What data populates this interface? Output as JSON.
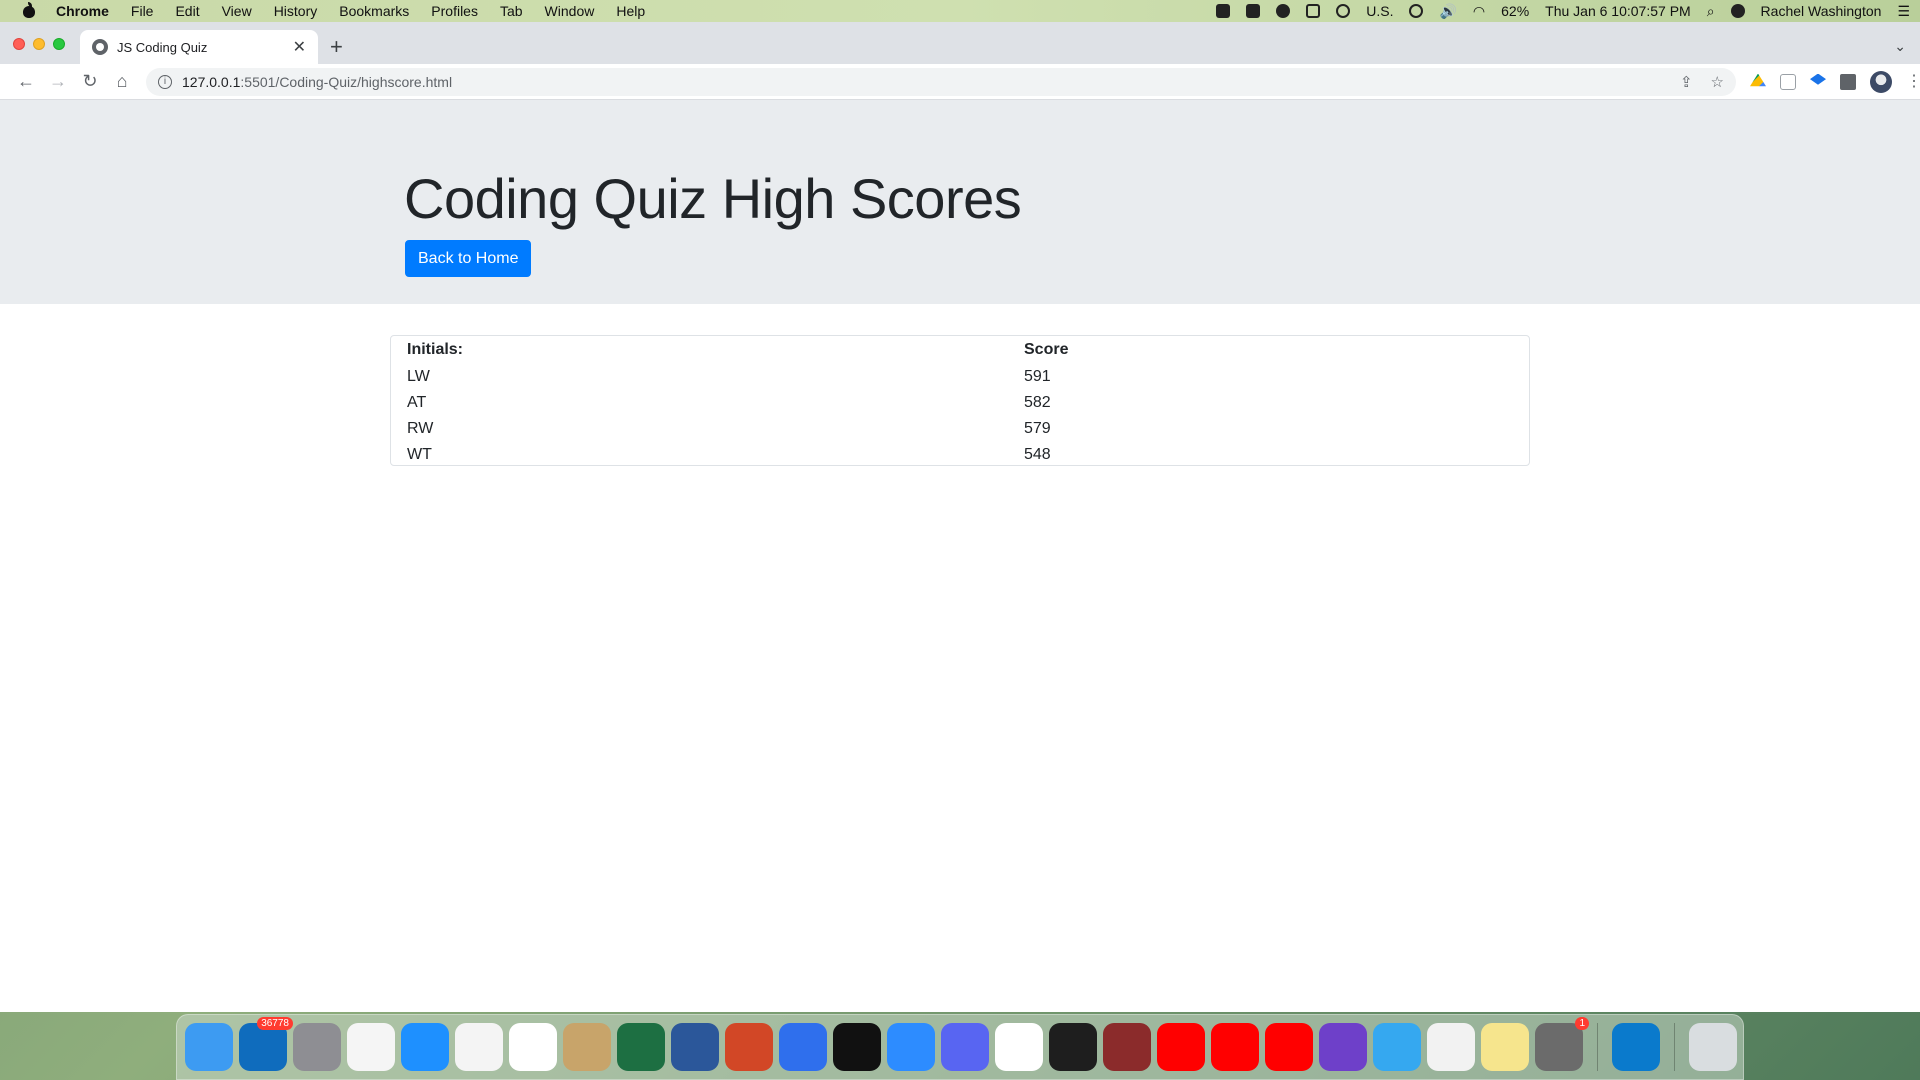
{
  "menubar": {
    "app": "Chrome",
    "items": [
      "File",
      "Edit",
      "View",
      "History",
      "Bookmarks",
      "Profiles",
      "Tab",
      "Window",
      "Help"
    ],
    "status": {
      "input_source": "U.S.",
      "battery": "62%",
      "datetime": "Thu Jan 6  10:07:57 PM",
      "user": "Rachel Washington"
    }
  },
  "browser": {
    "tab_title": "JS Coding Quiz",
    "url_host": "127.0.0.1",
    "url_path": ":5501/Coding-Quiz/highscore.html"
  },
  "page": {
    "title": "Coding Quiz High Scores",
    "back_button": "Back to Home",
    "table": {
      "headers": [
        "Initials:",
        "Score"
      ],
      "rows": [
        [
          "LW",
          "591"
        ],
        [
          "AT",
          "582"
        ],
        [
          "RW",
          "579"
        ],
        [
          "WT",
          "548"
        ]
      ]
    }
  },
  "dock": {
    "apps": [
      {
        "name": "finder-icon",
        "color": "#3d9bf2"
      },
      {
        "name": "outlook-icon",
        "color": "#0f6cbd",
        "badge": "36778"
      },
      {
        "name": "launchpad-icon",
        "color": "#8e8e93"
      },
      {
        "name": "photos-icon",
        "color": "#f5f5f5"
      },
      {
        "name": "safari-icon",
        "color": "#1e90ff"
      },
      {
        "name": "chrome-icon",
        "color": "#f4f4f4"
      },
      {
        "name": "calendar-icon",
        "color": "#ffffff"
      },
      {
        "name": "notes-calculator-icon",
        "color": "#c8a46a"
      },
      {
        "name": "excel-icon",
        "color": "#1d6f42"
      },
      {
        "name": "word-icon",
        "color": "#2b579a"
      },
      {
        "name": "powerpoint-icon",
        "color": "#d24726"
      },
      {
        "name": "pencil-app-icon",
        "color": "#2f6fed"
      },
      {
        "name": "kindle-icon",
        "color": "#111111"
      },
      {
        "name": "zoom-icon",
        "color": "#2d8cff"
      },
      {
        "name": "discord-icon",
        "color": "#5865f2"
      },
      {
        "name": "slack-icon",
        "color": "#ffffff"
      },
      {
        "name": "terminal-icon",
        "color": "#1e1e1e"
      },
      {
        "name": "dictionary-icon",
        "color": "#8b2b2b"
      },
      {
        "name": "youtube-icon",
        "color": "#ff0000"
      },
      {
        "name": "youtube-music-icon",
        "color": "#ff0000"
      },
      {
        "name": "youtube-tv-icon",
        "color": "#ff0000"
      },
      {
        "name": "github-icon",
        "color": "#6e40c9"
      },
      {
        "name": "messages-icon",
        "color": "#35a8f0"
      },
      {
        "name": "news-icon",
        "color": "#f2f2f2"
      },
      {
        "name": "stickies-icon",
        "color": "#f6e58d"
      },
      {
        "name": "system-preferences-icon",
        "color": "#6b6b6b",
        "badge": "1"
      },
      {
        "name": "vscode-icon",
        "color": "#0a7acc"
      },
      {
        "name": "trash-icon",
        "color": "#d9dde0"
      }
    ]
  }
}
